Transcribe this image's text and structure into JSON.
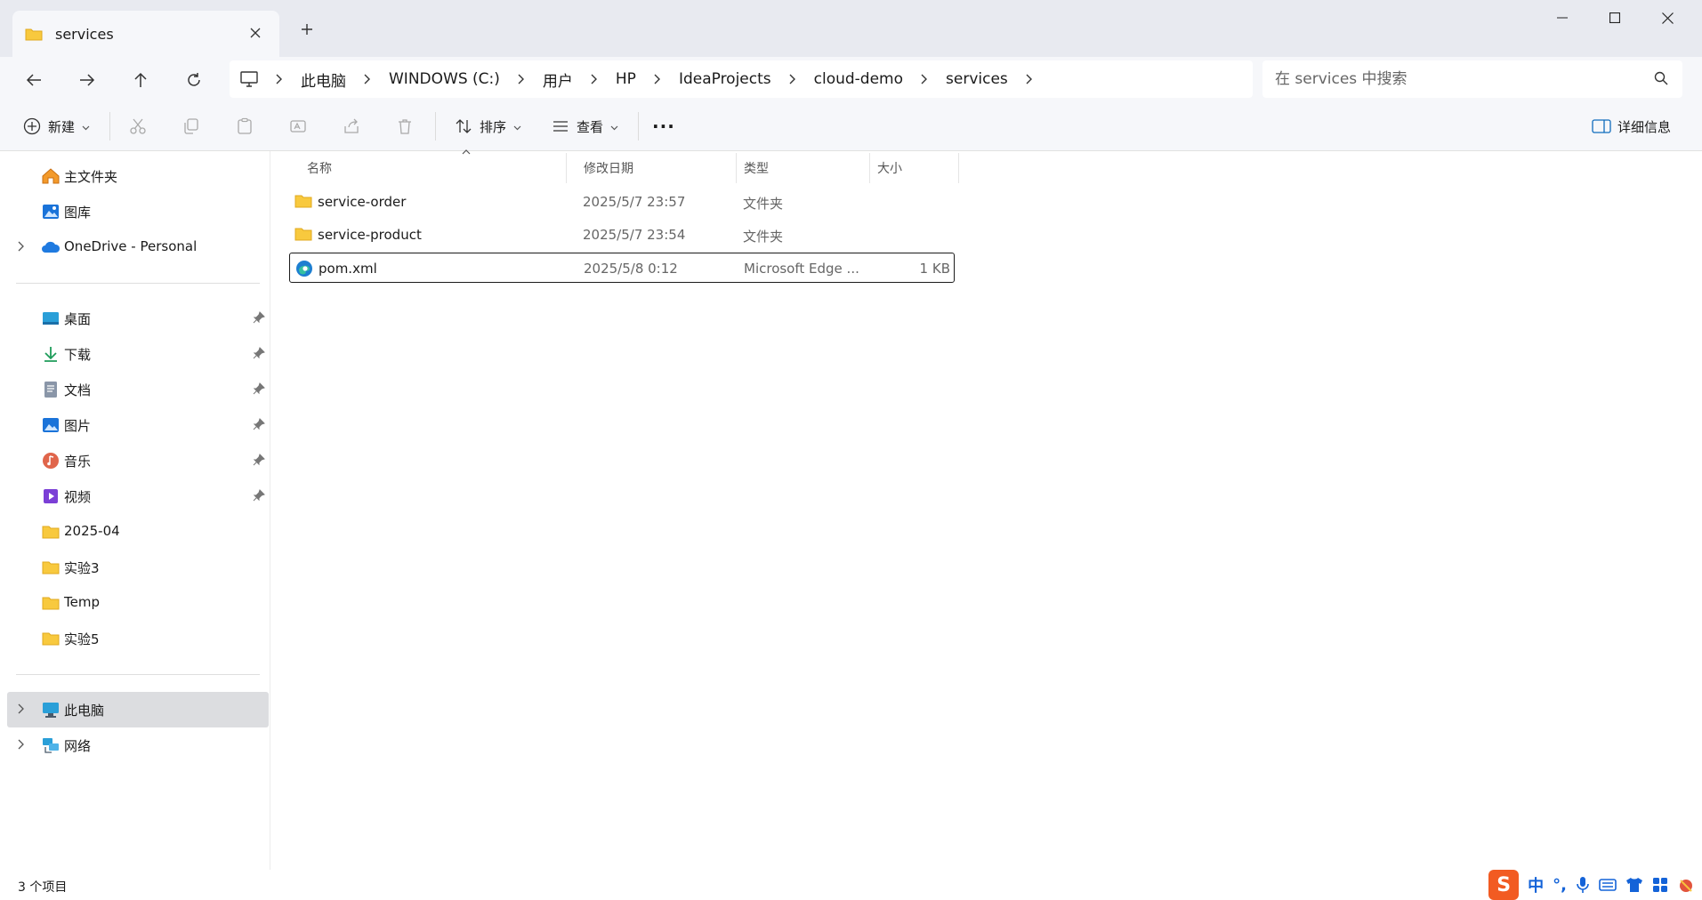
{
  "window": {
    "tab_title": "services",
    "new_tab_symbol": "+"
  },
  "address_bar": {
    "crumbs": [
      "此电脑",
      "WINDOWS (C:)",
      "用户",
      "HP",
      "IdeaProjects",
      "cloud-demo",
      "services"
    ],
    "search_placeholder": "在 services 中搜索"
  },
  "toolbar": {
    "new_label": "新建",
    "sort_label": "排序",
    "view_label": "查看",
    "more_label": "···",
    "details_label": "详细信息"
  },
  "sidebar": {
    "top_items": [
      {
        "label": "主文件夹",
        "icon": "home-icon"
      },
      {
        "label": "图库",
        "icon": "gallery-icon"
      },
      {
        "label": "OneDrive - Personal",
        "icon": "cloud-icon"
      }
    ],
    "quick_access": [
      {
        "label": "桌面",
        "icon": "desktop-icon",
        "pinned": true
      },
      {
        "label": "下载",
        "icon": "download-icon",
        "pinned": true
      },
      {
        "label": "文档",
        "icon": "document-icon",
        "pinned": true
      },
      {
        "label": "图片",
        "icon": "picture-icon",
        "pinned": true
      },
      {
        "label": "音乐",
        "icon": "music-icon",
        "pinned": true
      },
      {
        "label": "视频",
        "icon": "video-icon",
        "pinned": true
      },
      {
        "label": "2025-04",
        "icon": "folder-icon",
        "pinned": false
      },
      {
        "label": "实验3",
        "icon": "folder-icon",
        "pinned": false
      },
      {
        "label": "Temp",
        "icon": "folder-icon",
        "pinned": false
      },
      {
        "label": "实验5",
        "icon": "folder-icon",
        "pinned": false
      }
    ],
    "bottom_items": [
      {
        "label": "此电脑",
        "icon": "computer-icon",
        "selected": true
      },
      {
        "label": "网络",
        "icon": "network-icon",
        "selected": false
      }
    ]
  },
  "file_list": {
    "columns": [
      "名称",
      "修改日期",
      "类型",
      "大小"
    ],
    "rows": [
      {
        "name": "service-order",
        "date": "2025/5/7 23:57",
        "type": "文件夹",
        "size": "",
        "icon": "folder-icon"
      },
      {
        "name": "service-product",
        "date": "2025/5/7 23:54",
        "type": "文件夹",
        "size": "",
        "icon": "folder-icon"
      },
      {
        "name": "pom.xml",
        "date": "2025/5/8 0:12",
        "type": "Microsoft Edge ...",
        "size": "1 KB",
        "icon": "edge-icon"
      }
    ]
  },
  "status": {
    "item_count": "3 个项目"
  },
  "ime": {
    "logo": "S",
    "mode": "中",
    "punct": "°,"
  },
  "colors": {
    "folder": "#f8c93e",
    "accent": "#0f6cbd",
    "ime_brand": "#f25b22"
  }
}
